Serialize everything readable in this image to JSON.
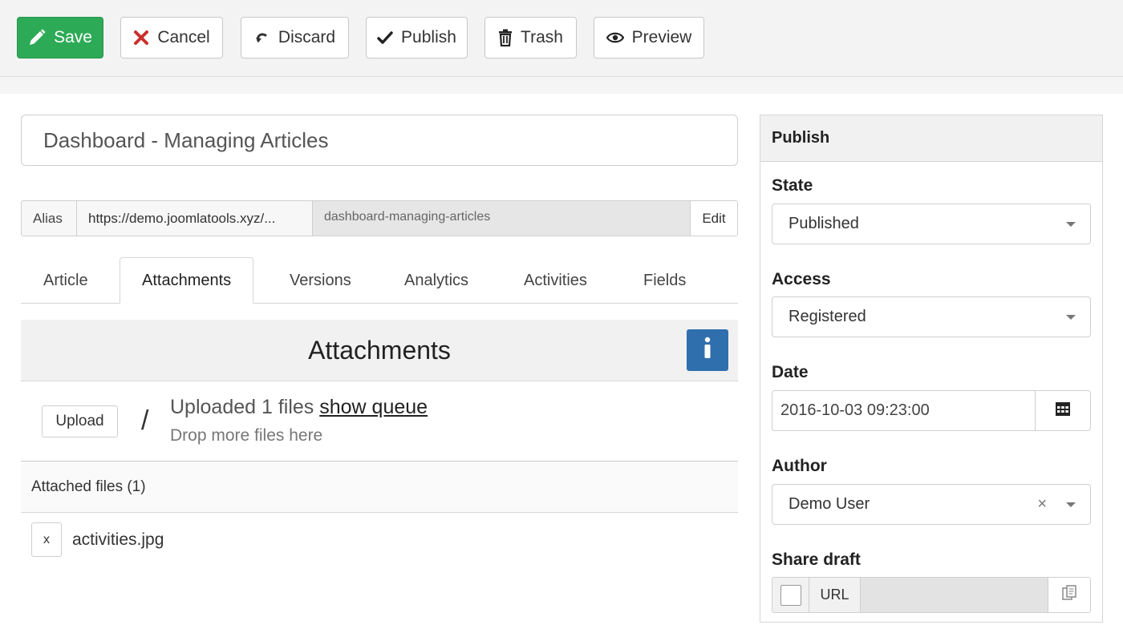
{
  "toolbar": {
    "save": "Save",
    "cancel": "Cancel",
    "discard": "Discard",
    "publish": "Publish",
    "trash": "Trash",
    "preview": "Preview"
  },
  "article": {
    "title": "Dashboard - Managing Articles",
    "alias_label": "Alias",
    "alias_url": "https://demo.joomlatools.xyz/...",
    "alias_slug": "dashboard-managing-articles",
    "alias_edit": "Edit"
  },
  "tabs": [
    "Article",
    "Attachments",
    "Versions",
    "Analytics",
    "Activities",
    "Fields"
  ],
  "attachments": {
    "heading": "Attachments",
    "upload_button": "Upload",
    "separator": "/",
    "status_prefix": "Uploaded 1 files",
    "show_queue": "show queue",
    "drop_hint": "Drop more files here",
    "files_header": "Attached files (1)",
    "files": [
      {
        "remove": "x",
        "name": "activities.jpg"
      }
    ]
  },
  "sidebar": {
    "title": "Publish",
    "state_label": "State",
    "state_value": "Published",
    "access_label": "Access",
    "access_value": "Registered",
    "date_label": "Date",
    "date_value": "2016-10-03 09:23:00",
    "author_label": "Author",
    "author_value": "Demo User",
    "author_clear": "×",
    "share_label": "Share draft",
    "share_url_label": "URL"
  },
  "colors": {
    "save": "#2daa56",
    "info": "#2f6fad",
    "cancel_icon": "#c9302c"
  },
  "icons": {
    "save": "pencil-icon",
    "cancel": "x-icon",
    "discard": "undo-icon",
    "publish": "check-icon",
    "trash": "trash-icon",
    "preview": "eye-icon",
    "info": "info-icon",
    "date": "calendar-icon",
    "share_copy": "copy-icon"
  }
}
